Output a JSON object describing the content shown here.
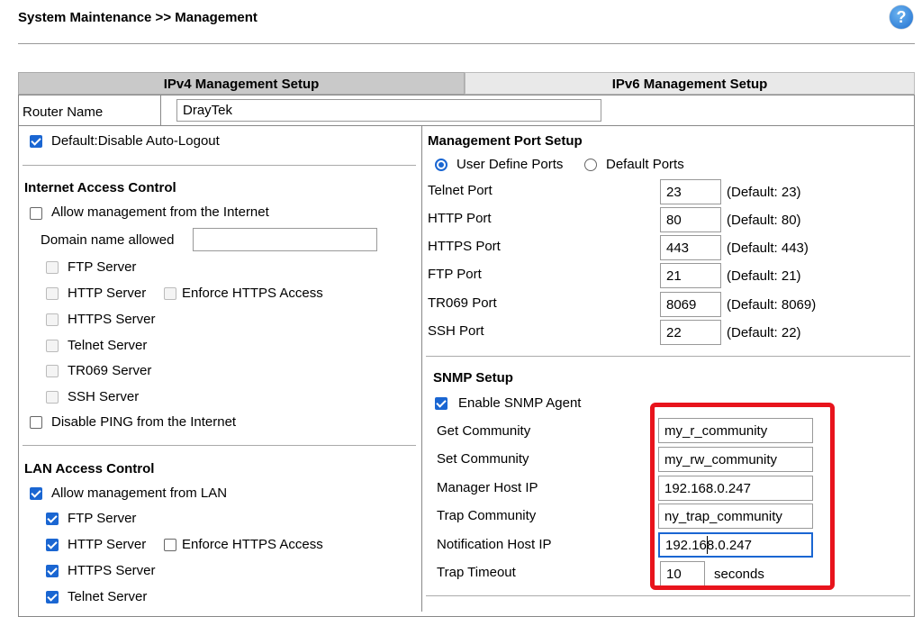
{
  "page": {
    "title": "System Maintenance >> Management",
    "help_icon": "?"
  },
  "tabs": {
    "ipv4": "IPv4 Management Setup",
    "ipv6": "IPv6 Management Setup"
  },
  "router_name": {
    "label": "Router Name",
    "value": "DrayTek"
  },
  "auto_logout": {
    "label": "Default:Disable Auto-Logout",
    "checked": true
  },
  "internet_access": {
    "heading": "Internet Access Control",
    "allow_label": "Allow management from the Internet",
    "domain_label": "Domain name allowed",
    "domain_value": "",
    "ftp": "FTP Server",
    "http": "HTTP Server",
    "enforce_https": "Enforce HTTPS Access",
    "https": "HTTPS Server",
    "telnet": "Telnet Server",
    "tr069": "TR069 Server",
    "ssh": "SSH Server",
    "disable_ping": "Disable PING from the Internet"
  },
  "lan_access": {
    "heading": "LAN Access Control",
    "allow_label": "Allow management from LAN",
    "ftp": "FTP Server",
    "http": "HTTP Server",
    "enforce_https": "Enforce HTTPS Access",
    "https": "HTTPS Server",
    "telnet": "Telnet Server"
  },
  "mgmt_port": {
    "heading": "Management Port Setup",
    "user_define": "User Define Ports",
    "default_ports": "Default Ports",
    "rows": [
      {
        "label": "Telnet Port",
        "value": "23",
        "default": "(Default: 23)"
      },
      {
        "label": "HTTP Port",
        "value": "80",
        "default": "(Default: 80)"
      },
      {
        "label": "HTTPS Port",
        "value": "443",
        "default": "(Default: 443)"
      },
      {
        "label": "FTP Port",
        "value": "21",
        "default": "(Default: 21)"
      },
      {
        "label": "TR069 Port",
        "value": "8069",
        "default": "(Default: 8069)"
      },
      {
        "label": "SSH Port",
        "value": "22",
        "default": "(Default: 22)"
      }
    ]
  },
  "snmp": {
    "heading": "SNMP Setup",
    "enable_label": "Enable SNMP Agent",
    "get_community_label": "Get Community",
    "get_community": "my_r_community",
    "set_community_label": "Set Community",
    "set_community": "my_rw_community",
    "manager_host_label": "Manager Host IP",
    "manager_host": "192.168.0.247",
    "trap_community_label": "Trap Community",
    "trap_community": "ny_trap_community",
    "notification_host_label": "Notification Host IP",
    "notification_host": "192.168.0.247",
    "trap_timeout_label": "Trap Timeout",
    "trap_timeout": "10",
    "seconds": "seconds"
  },
  "colors": {
    "accent": "#1a66d2",
    "highlight_box": "#e8141c",
    "tab_active": "#c9c9c9",
    "tab_inactive": "#e9e9e9"
  }
}
